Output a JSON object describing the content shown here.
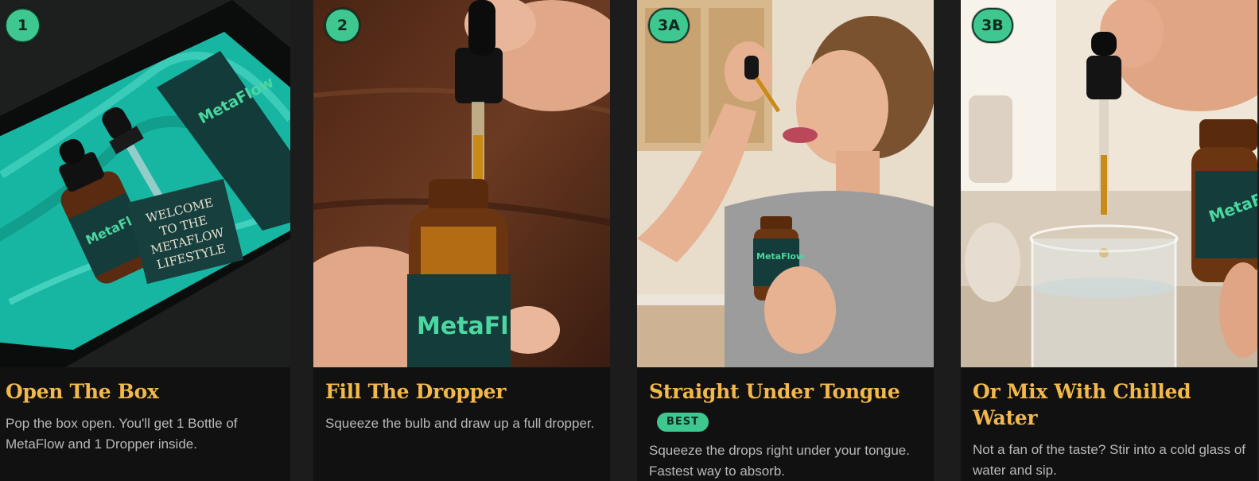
{
  "steps": [
    {
      "badge": "1",
      "title": "Open The Box",
      "description": "Pop the box open. You'll get 1 Bottle of MetaFlow and 1 Dropper inside.",
      "image": {
        "brand_label": "MetaFlow",
        "card_text": [
          "WELCOME",
          "TO THE",
          "METAFLOW",
          "LIFESTYLE"
        ]
      }
    },
    {
      "badge": "2",
      "title": "Fill The Dropper",
      "description": "Squeeze the bulb and draw up a full dropper.",
      "image": {
        "brand_label": "MetaFl"
      }
    },
    {
      "badge": "3A",
      "title": "Straight Under Tongue",
      "tag": "BEST",
      "description": "Squeeze the drops right under your tongue. Fastest way to absorb.",
      "image": {
        "brand_label": "MetaFlow"
      }
    },
    {
      "badge": "3B",
      "title": "Or Mix With Chilled Water",
      "description": "Not a fan of the taste? Stir into a cold glass of water and sip.",
      "image": {
        "brand_label": "MetaFl"
      }
    }
  ],
  "colors": {
    "accent_green": "#3ec890",
    "title_gold": "#f2b84b",
    "card_bg": "#111111",
    "text_muted": "#b9b9b9"
  }
}
